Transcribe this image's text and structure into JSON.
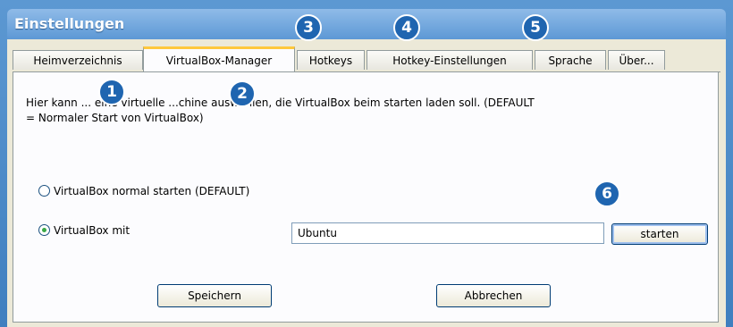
{
  "window": {
    "title": "Einstellungen"
  },
  "tabs": [
    {
      "label": "Heimverzeichnis"
    },
    {
      "label": "VirtualBox-Manager"
    },
    {
      "label": "Hotkeys"
    },
    {
      "label": "Hotkey-Einstellungen"
    },
    {
      "label": "Sprache"
    },
    {
      "label": "Über..."
    }
  ],
  "panel": {
    "description_line1": "Hier kann ... eine virtuelle ...chine auswählen, die VirtualBox beim starten laden soll. (DEFAULT",
    "description_line2": "= Normaler Start von VirtualBox)",
    "radio_default_label": "VirtualBox normal starten (DEFAULT)",
    "radio_with_label": "VirtualBox mit",
    "vm_field_value": "Ubuntu",
    "start_button_label": "starten"
  },
  "footer": {
    "save_label": "Speichern",
    "cancel_label": "Abbrechen"
  },
  "badges": [
    "1",
    "2",
    "3",
    "4",
    "5",
    "6"
  ],
  "colors": {
    "badge": "#1f65b0",
    "active_tab_accent": "#ffc83c",
    "radio_checked": "#3aa847"
  }
}
